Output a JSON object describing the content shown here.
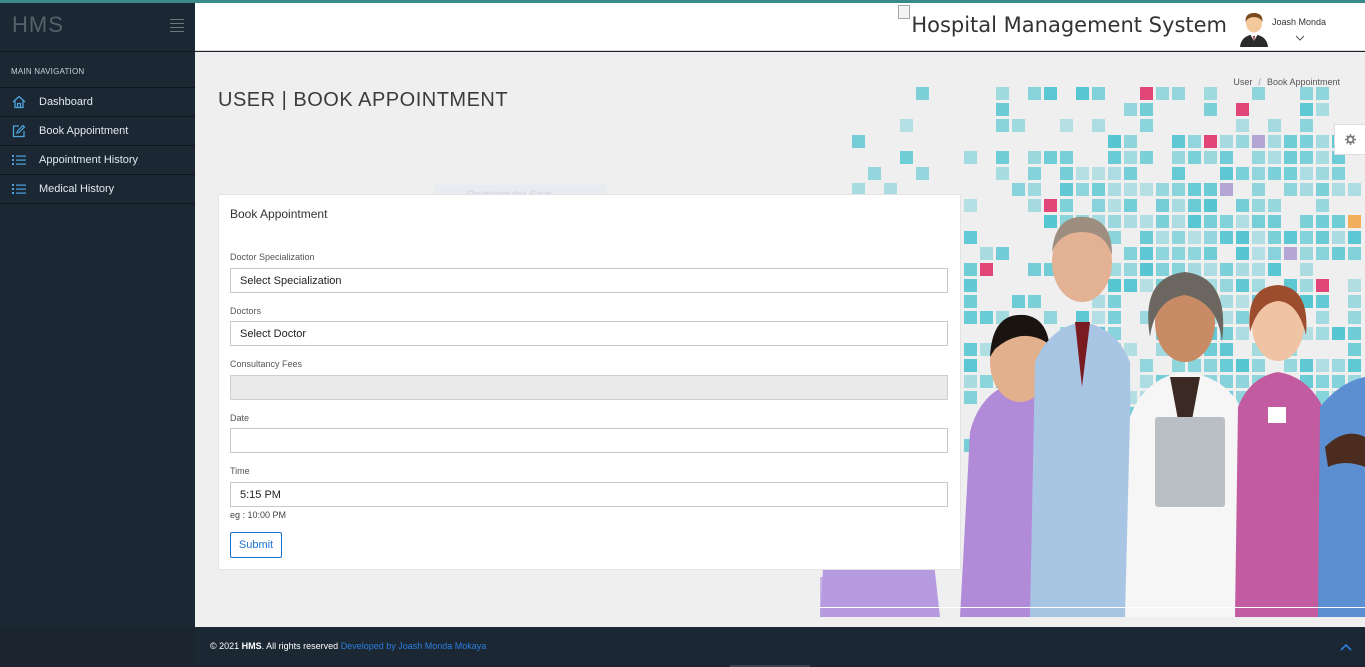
{
  "brand": "HMS",
  "sidebar": {
    "section_title": "MAIN NAVIGATION",
    "items": [
      {
        "label": "Dashboard",
        "icon": "home-icon"
      },
      {
        "label": "Book Appointment",
        "icon": "edit-icon"
      },
      {
        "label": "Appointment History",
        "icon": "list-icon"
      },
      {
        "label": "Medical History",
        "icon": "list-icon"
      }
    ]
  },
  "header": {
    "app_title": "Hospital Management System",
    "user_name": "Joash Monda"
  },
  "page": {
    "title": "USER | BOOK APPOINTMENT",
    "breadcrumb": [
      "User",
      "Book Appointment"
    ],
    "ghost_text": "Rectangular Snip"
  },
  "form": {
    "panel_title": "Book Appointment",
    "fields": {
      "specialization": {
        "label": "Doctor Specialization",
        "value": "Select Specialization"
      },
      "doctor": {
        "label": "Doctors",
        "value": "Select Doctor"
      },
      "fees": {
        "label": "Consultancy Fees",
        "value": ""
      },
      "date": {
        "label": "Date",
        "value": ""
      },
      "time": {
        "label": "Time",
        "value": "5:15 PM"
      }
    },
    "time_hint": "eg : 10:00 PM",
    "submit_label": "Submit"
  },
  "footer": {
    "copyright": "© 2021 ",
    "brand": "HMS",
    "rights": ". All rights reserved ",
    "dev_link": "Developed by Joash Monda Mokaya"
  },
  "colors": {
    "sidebar_bg": "#1b2733",
    "accent": "#1a72d6",
    "icon_color": "#4ea6e0",
    "tile_teal": "#4cc3cf",
    "tile_pink": "#e0336b"
  }
}
